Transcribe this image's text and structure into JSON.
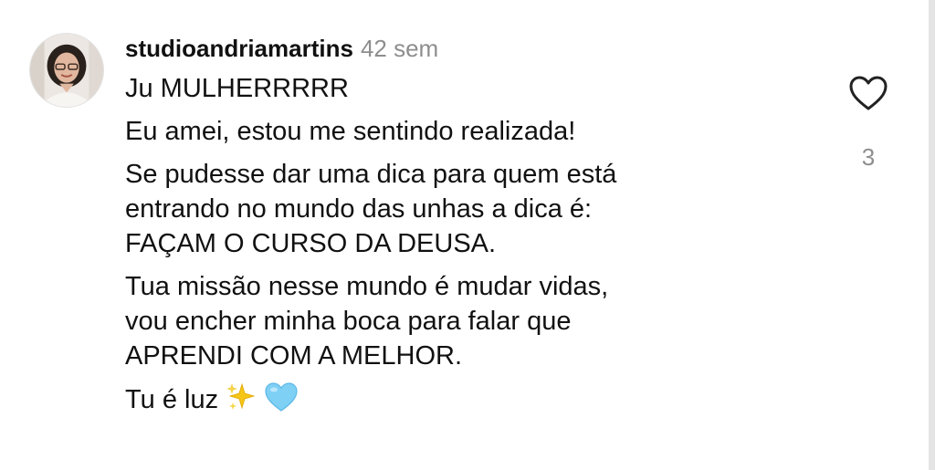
{
  "comment": {
    "username": "studioandriamartins",
    "timestamp": "42 sem",
    "paragraphs": [
      [
        "Ju MULHERRRRR"
      ],
      [
        "Eu amei, estou me sentindo realizada!"
      ],
      [
        "Se pudesse dar uma dica para quem está",
        "entrando no mundo das unhas a dica é:",
        "FAÇAM O CURSO DA DEUSA."
      ],
      [
        "Tua missão nesse mundo é mudar vidas,",
        "vou encher minha boca para falar que",
        "APRENDI COM A MELHOR."
      ],
      [
        "Tu é luz"
      ]
    ],
    "trailing_emojis": [
      "sparkles-icon",
      "light-blue-heart-icon"
    ],
    "like_count": "3",
    "like_icon": "heart-outline-icon"
  },
  "colors": {
    "text": "#111111",
    "secondary_text": "#8e8e8e",
    "sparkles": "#f5c518",
    "blue_heart": "#7fd0f5"
  }
}
